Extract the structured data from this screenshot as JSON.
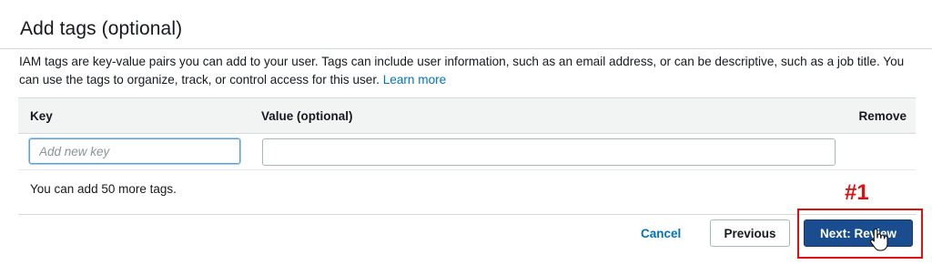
{
  "section": {
    "title": "Add tags (optional)",
    "description": "IAM tags are key-value pairs you can add to your user. Tags can include user information, such as an email address, or can be descriptive, such as a job title. You can use the tags to organize, track, or control access for this user.",
    "learn_more_label": "Learn more"
  },
  "table": {
    "columns": [
      "Key",
      "Value (optional)",
      "Remove"
    ],
    "key_input": {
      "value": "",
      "placeholder": "Add new key"
    },
    "value_input": {
      "value": "",
      "placeholder": ""
    }
  },
  "footer": {
    "remaining_tags_text": "You can add 50 more tags."
  },
  "actions": {
    "cancel_label": "Cancel",
    "previous_label": "Previous",
    "next_label": "Next: Review"
  },
  "annotation": {
    "label": "#1",
    "color": "#e01010"
  },
  "colors": {
    "primary_button": "#1a4d8f",
    "link": "#0073bb",
    "header_bg": "#f2f3f3"
  },
  "icons": {
    "cursor": "hand-pointer-icon"
  }
}
